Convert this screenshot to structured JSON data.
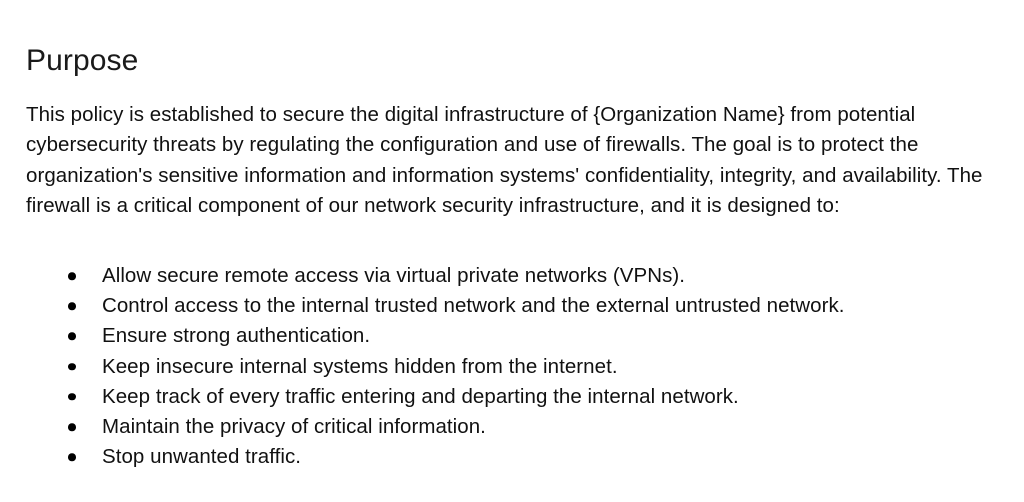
{
  "document": {
    "heading": "Purpose",
    "paragraph": "This policy is established to secure the digital infrastructure of {Organization Name} from potential cybersecurity threats by regulating the configuration and use of firewalls. The goal is to protect the organization's sensitive information and information systems' confidentiality, integrity, and availability. The firewall is a critical component of our network security infrastructure, and it is designed to:",
    "bullet_marker_icon": "bullet-disc-icon",
    "bullets": [
      "Allow secure remote access via virtual private networks (VPNs).",
      "Control access to the internal trusted network and the external untrusted network.",
      "Ensure strong authentication.",
      "Keep insecure internal systems hidden from the internet.",
      "Keep track of every traffic entering and departing the internal network.",
      "Maintain the privacy of critical information.",
      "Stop unwanted traffic."
    ],
    "colors": {
      "background": "#ffffff",
      "text": "#111111",
      "heading": "#1a1a1a",
      "bullet": "#000000"
    }
  }
}
